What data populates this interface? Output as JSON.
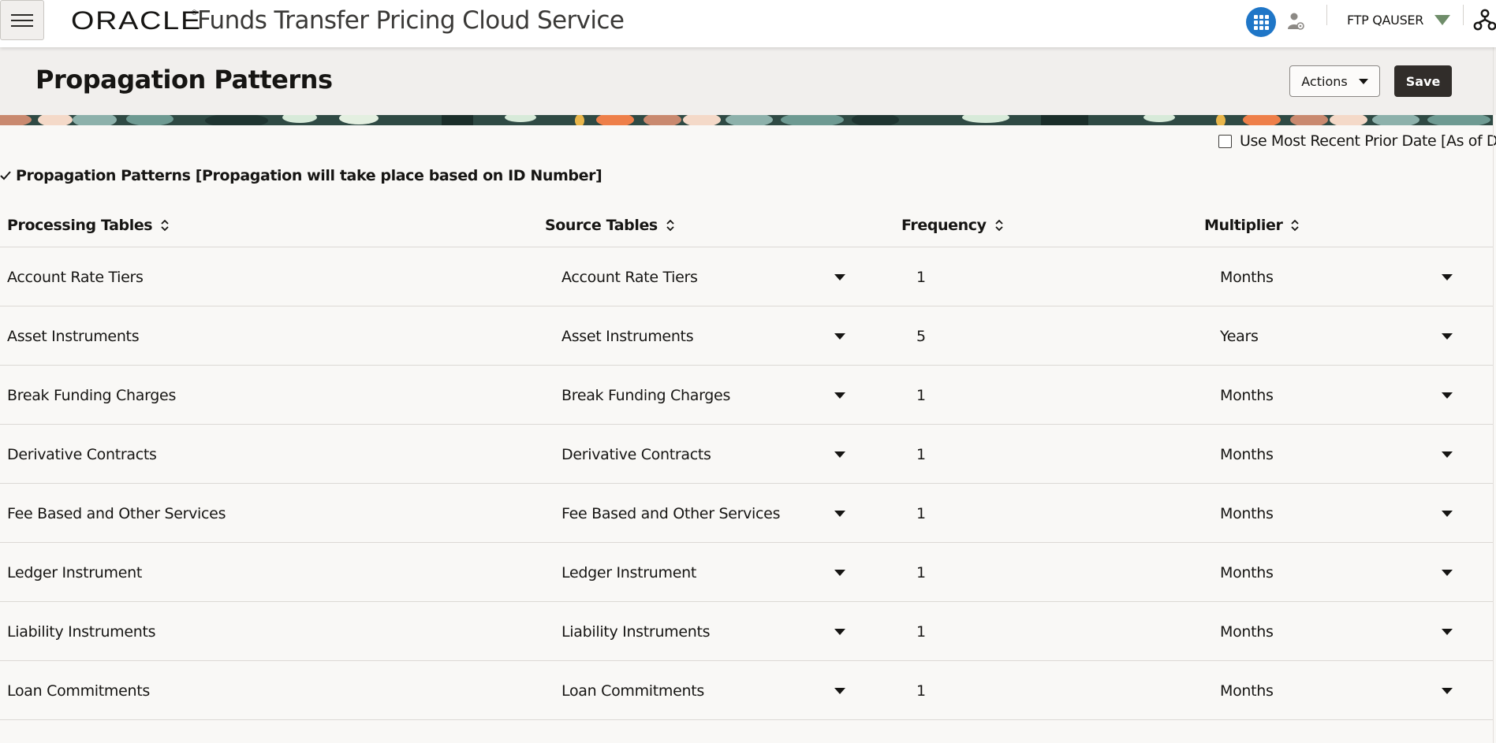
{
  "header": {
    "brand": "ORACLE",
    "app_title": "Funds Transfer Pricing Cloud Service",
    "user_name": "FTP QAUSER"
  },
  "page": {
    "title": "Propagation Patterns",
    "actions_label": "Actions",
    "save_label": "Save"
  },
  "options": {
    "recent_date_label": "Use Most Recent Prior Date [As of Date]",
    "recent_date_checked": false
  },
  "section": {
    "title": "Propagation Patterns [Propagation will take place based on ID Number]"
  },
  "table": {
    "columns": [
      "Processing Tables",
      "Source Tables",
      "Frequency",
      "Multiplier"
    ],
    "rows": [
      {
        "processing": "Account Rate Tiers",
        "source": "Account Rate Tiers",
        "frequency": "1",
        "multiplier": "Months"
      },
      {
        "processing": "Asset Instruments",
        "source": "Asset Instruments",
        "frequency": "5",
        "multiplier": "Years"
      },
      {
        "processing": "Break Funding Charges",
        "source": "Break Funding Charges",
        "frequency": "1",
        "multiplier": "Months"
      },
      {
        "processing": "Derivative Contracts",
        "source": "Derivative Contracts",
        "frequency": "1",
        "multiplier": "Months"
      },
      {
        "processing": "Fee Based and Other Services",
        "source": "Fee Based and Other Services",
        "frequency": "1",
        "multiplier": "Months"
      },
      {
        "processing": "Ledger Instrument",
        "source": "Ledger Instrument",
        "frequency": "1",
        "multiplier": "Months"
      },
      {
        "processing": "Liability Instruments",
        "source": "Liability Instruments",
        "frequency": "1",
        "multiplier": "Months"
      },
      {
        "processing": "Loan Commitments",
        "source": "Loan Commitments",
        "frequency": "1",
        "multiplier": "Months"
      }
    ]
  },
  "colors": {
    "accent_blue": "#1f76c7",
    "save_bg": "#312d2a",
    "header_bg": "#f1efed",
    "user_caret": "#6f8d6a"
  },
  "icons": {
    "menu": "hamburger-menu-icon",
    "apps": "app-grid-icon",
    "person": "person-settings-icon",
    "hierarchy": "hierarchy-icon",
    "sort": "sort-icon",
    "dropdown": "chevron-down-icon",
    "expand": "check-expand-icon"
  }
}
